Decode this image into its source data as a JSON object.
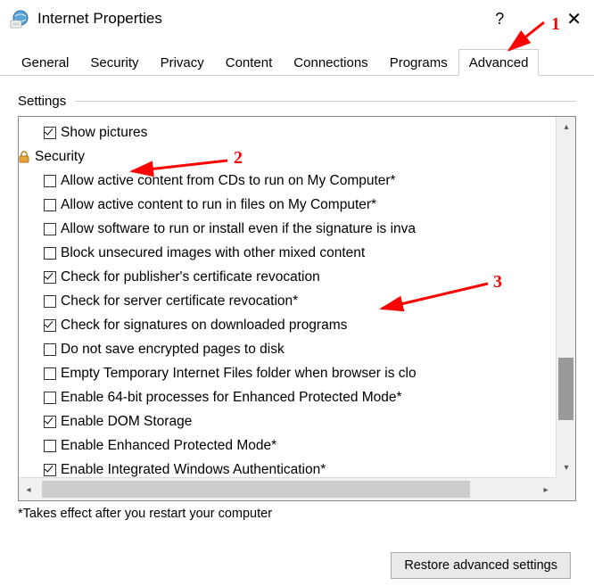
{
  "window": {
    "title": "Internet Properties"
  },
  "tabs": [
    "General",
    "Security",
    "Privacy",
    "Content",
    "Connections",
    "Programs",
    "Advanced"
  ],
  "activeTab": "Advanced",
  "settings": {
    "heading": "Settings",
    "items": [
      {
        "type": "check",
        "label": "Show pictures",
        "checked": true,
        "level": 1
      },
      {
        "type": "category",
        "label": "Security",
        "icon": "lock"
      },
      {
        "type": "check",
        "label": "Allow active content from CDs to run on My Computer*",
        "checked": false,
        "level": 2
      },
      {
        "type": "check",
        "label": "Allow active content to run in files on My Computer*",
        "checked": false,
        "level": 2
      },
      {
        "type": "check",
        "label": "Allow software to run or install even if the signature is inva",
        "checked": false,
        "level": 2
      },
      {
        "type": "check",
        "label": "Block unsecured images with other mixed content",
        "checked": false,
        "level": 2
      },
      {
        "type": "check",
        "label": "Check for publisher's certificate revocation",
        "checked": true,
        "level": 2
      },
      {
        "type": "check",
        "label": "Check for server certificate revocation*",
        "checked": false,
        "level": 2
      },
      {
        "type": "check",
        "label": "Check for signatures on downloaded programs",
        "checked": true,
        "level": 2
      },
      {
        "type": "check",
        "label": "Do not save encrypted pages to disk",
        "checked": false,
        "level": 2
      },
      {
        "type": "check",
        "label": "Empty Temporary Internet Files folder when browser is clo",
        "checked": false,
        "level": 2
      },
      {
        "type": "check",
        "label": "Enable 64-bit processes for Enhanced Protected Mode*",
        "checked": false,
        "level": 2
      },
      {
        "type": "check",
        "label": "Enable DOM Storage",
        "checked": true,
        "level": 2
      },
      {
        "type": "check",
        "label": "Enable Enhanced Protected Mode*",
        "checked": false,
        "level": 2
      },
      {
        "type": "check",
        "label": "Enable Integrated Windows Authentication*",
        "checked": true,
        "level": 2
      }
    ]
  },
  "note": "*Takes effect after you restart your computer",
  "buttons": {
    "restore": "Restore advanced settings"
  },
  "annotations": [
    {
      "id": "1",
      "label": "1"
    },
    {
      "id": "2",
      "label": "2"
    },
    {
      "id": "3",
      "label": "3"
    }
  ]
}
